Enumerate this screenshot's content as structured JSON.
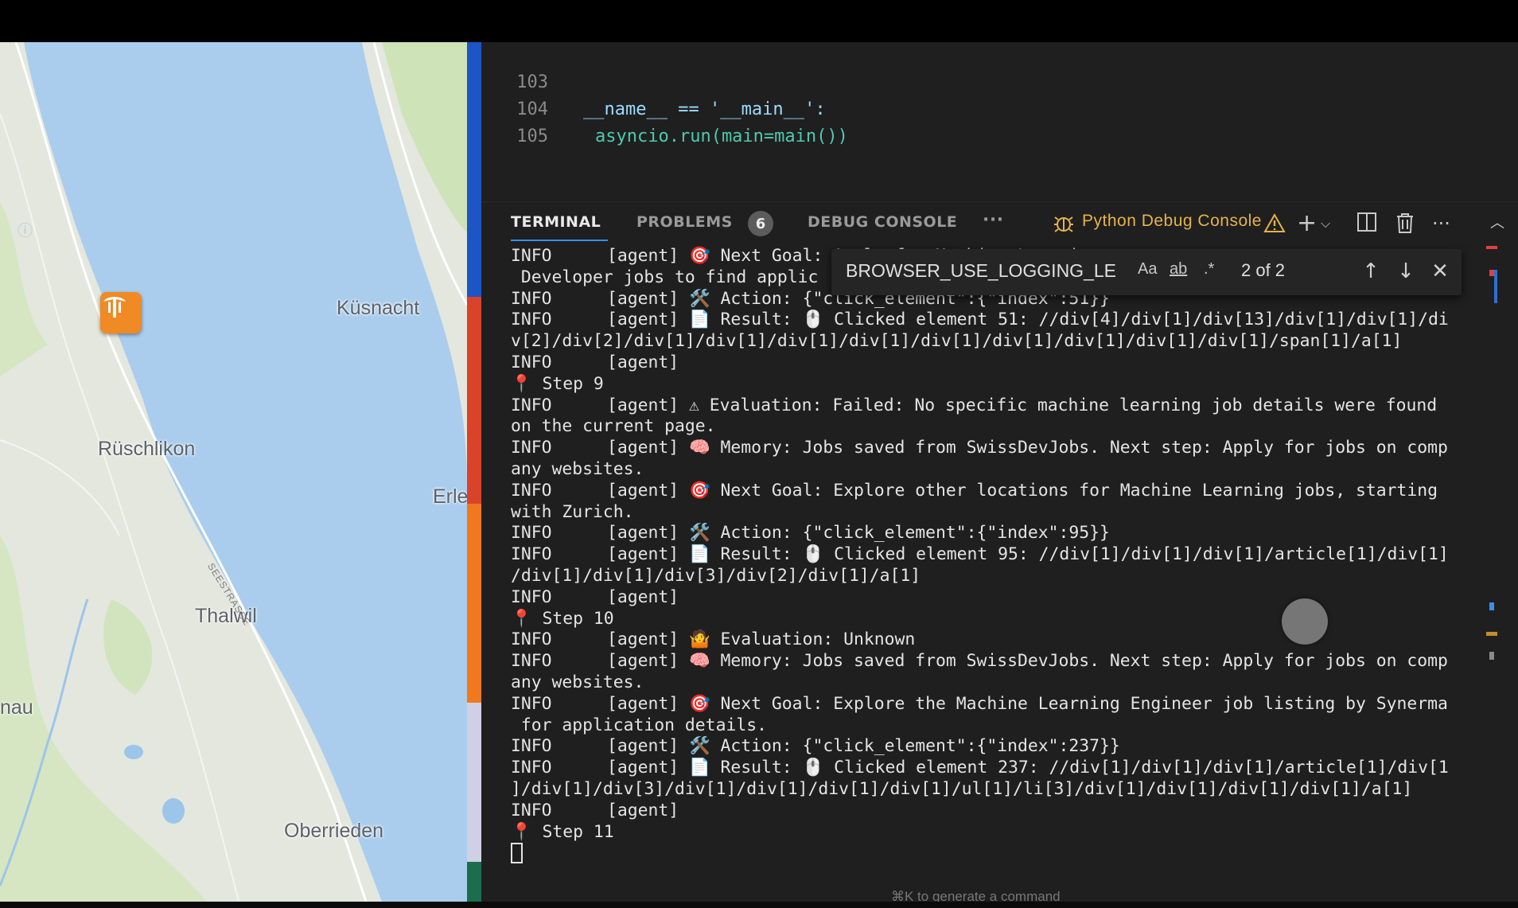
{
  "map": {
    "places": {
      "kusnacht": "Küsnacht",
      "ruschlikon": "Rüschlikon",
      "thalwil": "Thalwil",
      "erle": "Erle",
      "oberrieden": "Oberrieden",
      "nau": "nau"
    },
    "road_label": "SEESTRASSE",
    "marker_icon": "transit-marker-icon",
    "colors": {
      "water": "#aacdee",
      "land": "#e3e7de",
      "park": "#cfe3b8",
      "marker": "#f08a24"
    }
  },
  "editor": {
    "lines": [
      {
        "num": "103",
        "code": "__name__ == '__main__':"
      },
      {
        "num": "104",
        "code": "asyncio.run(main=main())"
      },
      {
        "num": "105",
        "code": ""
      }
    ]
  },
  "panel": {
    "tabs": {
      "terminal": "TERMINAL",
      "problems": "PROBLEMS",
      "problems_count": "6",
      "debug_console": "DEBUG CONSOLE",
      "more": "···"
    },
    "session_name": "Python Debug Console",
    "icons": [
      "debug-icon",
      "warning-icon",
      "plus-icon",
      "chevron-down-icon",
      "split-icon",
      "trash-icon",
      "more-icon",
      "chevron-up-icon"
    ]
  },
  "find_widget": {
    "query": "BROWSER_USE_LOGGING_LE",
    "match_case": "Aa",
    "whole_word": "ab",
    "regex": ".*",
    "count": "2 of 2"
  },
  "terminal": {
    "lines": [
      {
        "lvl": "INFO",
        "text": "[agent] 🎯 Next Goal: Apply for Machine Learning"
      },
      {
        "lvl": "",
        "text": " Developer jobs to find applic"
      },
      {
        "lvl": "INFO",
        "text": "[agent] 🛠️ Action: {\"click_element\":{\"index\":51}}"
      },
      {
        "lvl": "INFO",
        "text": "[agent] 📄 Result: 🖱️ Clicked element 51: //div[4]/div[1]/div[13]/div[1]/div[1]/di"
      },
      {
        "lvl": "",
        "text": "v[2]/div[2]/div[1]/div[1]/div[1]/div[1]/div[1]/div[1]/div[1]/div[1]/div[1]/span[1]/a[1]"
      },
      {
        "lvl": "INFO",
        "text": "[agent]"
      },
      {
        "lvl": "",
        "text": "📍 Step 9"
      },
      {
        "lvl": "INFO",
        "text": "[agent] ⚠ Evaluation: Failed: No specific machine learning job details were found"
      },
      {
        "lvl": "",
        "text": "on the current page."
      },
      {
        "lvl": "INFO",
        "text": "[agent] 🧠 Memory: Jobs saved from SwissDevJobs. Next step: Apply for jobs on comp"
      },
      {
        "lvl": "",
        "text": "any websites."
      },
      {
        "lvl": "INFO",
        "text": "[agent] 🎯 Next Goal: Explore other locations for Machine Learning jobs, starting"
      },
      {
        "lvl": "",
        "text": "with Zurich."
      },
      {
        "lvl": "INFO",
        "text": "[agent] 🛠️ Action: {\"click_element\":{\"index\":95}}"
      },
      {
        "lvl": "INFO",
        "text": "[agent] 📄 Result: 🖱️ Clicked element 95: //div[1]/div[1]/div[1]/article[1]/div[1]"
      },
      {
        "lvl": "",
        "text": "/div[1]/div[1]/div[3]/div[2]/div[1]/a[1]"
      },
      {
        "lvl": "INFO",
        "text": "[agent]"
      },
      {
        "lvl": "",
        "text": "📍 Step 10"
      },
      {
        "lvl": "INFO",
        "text": "[agent] 🤷 Evaluation: Unknown"
      },
      {
        "lvl": "INFO",
        "text": "[agent] 🧠 Memory: Jobs saved from SwissDevJobs. Next step: Apply for jobs on comp"
      },
      {
        "lvl": "",
        "text": "any websites."
      },
      {
        "lvl": "INFO",
        "text": "[agent] 🎯 Next Goal: Explore the Machine Learning Engineer job listing by Synerma"
      },
      {
        "lvl": "",
        "text": " for application details."
      },
      {
        "lvl": "INFO",
        "text": "[agent] 🛠️ Action: {\"click_element\":{\"index\":237}}"
      },
      {
        "lvl": "INFO",
        "text": "[agent] 📄 Result: 🖱️ Clicked element 237: //div[1]/div[1]/div[1]/article[1]/div[1"
      },
      {
        "lvl": "",
        "text": "]/div[1]/div[3]/div[1]/div[1]/div[1]/div[1]/ul[1]/li[3]/div[1]/div[1]/div[1]/div[1]/a[1]"
      },
      {
        "lvl": "INFO",
        "text": "[agent]"
      },
      {
        "lvl": "",
        "text": "📍 Step 11"
      }
    ],
    "hint": "⌘K to generate a command"
  }
}
